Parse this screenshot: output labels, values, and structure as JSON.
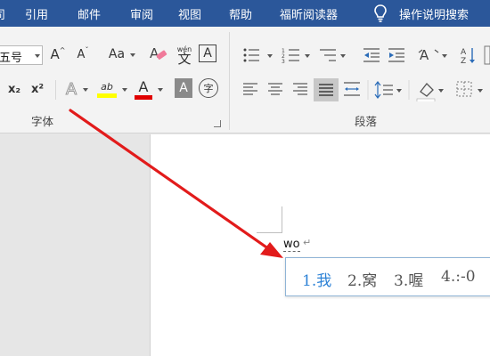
{
  "menubar": {
    "partial_tab": "司",
    "tabs": [
      "引用",
      "邮件",
      "审阅",
      "视图",
      "帮助",
      "福昕阅读器"
    ],
    "tell_me": "操作说明搜索"
  },
  "ribbon": {
    "font_group": {
      "label": "字体",
      "font_size": "五号",
      "grow_font": "A",
      "shrink_font": "A",
      "change_case": "Aa",
      "phonetic_top": "wén",
      "phonetic_char": "文",
      "char_border": "A",
      "subscript": "x₂",
      "superscript": "x²",
      "text_effects": "A",
      "highlight": "ab",
      "font_color": "A",
      "char_shading": "A",
      "enclose_char": "字",
      "colors": {
        "highlight": "#ffff00",
        "font_color": "#e00000"
      }
    },
    "paragraph_group": {
      "label": "段落"
    }
  },
  "document": {
    "typed_text": "wo",
    "paragraph_mark": "↵"
  },
  "ime": {
    "candidates": [
      "1.我",
      "2.窝",
      "3.喔",
      "4.:-0"
    ],
    "selected_index": 0
  },
  "annotation": {
    "arrow_color": "#e21b1b"
  }
}
